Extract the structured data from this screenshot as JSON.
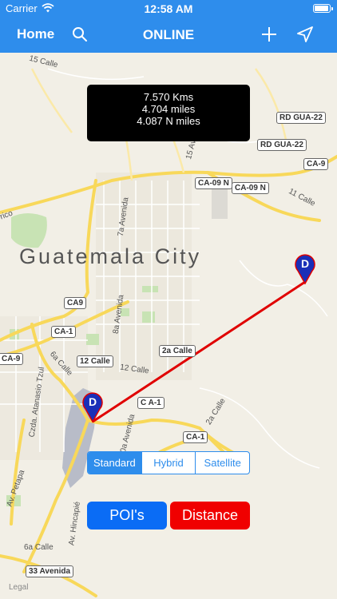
{
  "status_bar": {
    "carrier": "Carrier",
    "time": "12:58 AM"
  },
  "nav": {
    "home_label": "Home",
    "title": "ONLINE"
  },
  "distance": {
    "kms": "7.570 Kms",
    "miles": "4.704 miles",
    "nmiles": "4.087 N miles"
  },
  "map": {
    "city": "Guatemala City",
    "road_labels": [
      "RD GUA-22",
      "RD GUA-22",
      "CA-9",
      "CA-09 N",
      "CA-09 N",
      "CA9",
      "CA-1",
      "CA-9",
      "12 Calle",
      "2a Calle",
      "C A-1",
      "CA-1",
      "33 Avenida"
    ],
    "street_labels": [
      "15 Calle",
      "15 Avenida",
      "7a Avenida",
      "8a Avenida",
      "11 Calle",
      "12 Calle",
      "6a Calle",
      "2a Calle",
      "10a Avenida",
      "Av. Hincapié",
      "Av. Petapa",
      "Czda. Atanasio Tzul",
      "6a Calle",
      "rico"
    ],
    "pin_letter": "D",
    "legal": "Legal"
  },
  "map_type": {
    "options": [
      "Standard",
      "Hybrid",
      "Satellite"
    ],
    "selected": "Standard"
  },
  "buttons": {
    "poi": "POI's",
    "distance": "Distance"
  },
  "colors": {
    "accent": "#2e8dec",
    "route_line": "#e00000",
    "pin": "#1a2fb8",
    "distance_button": "#f00000",
    "poi_button": "#0a6cf5"
  },
  "icons": {
    "search": "search-icon",
    "add": "plus-icon",
    "location": "location-arrow-icon",
    "wifi": "wifi-icon",
    "battery": "battery-icon"
  }
}
